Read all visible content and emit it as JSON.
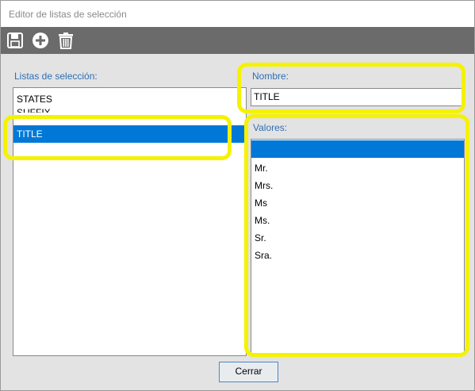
{
  "window": {
    "title": "Editor de listas de selección"
  },
  "toolbar": {
    "buttons": [
      {
        "icon": "save-icon"
      },
      {
        "icon": "add-icon"
      },
      {
        "icon": "delete-icon"
      }
    ]
  },
  "lists_panel": {
    "label": "Listas de selección:",
    "items": [
      {
        "label": "STATES"
      },
      {
        "label": "SUFFIX"
      },
      {
        "label": "TITLE",
        "selected": true
      }
    ]
  },
  "name_field": {
    "label": "Nombre:",
    "value": "TITLE"
  },
  "values_panel": {
    "label": "Valores:",
    "items": [
      {
        "label": "",
        "selected": true
      },
      {
        "label": "Mr."
      },
      {
        "label": "Mrs."
      },
      {
        "label": "Ms"
      },
      {
        "label": "Ms."
      },
      {
        "label": "Sr."
      },
      {
        "label": "Sra."
      }
    ]
  },
  "close_button": {
    "label": "Cerrar"
  },
  "colors": {
    "toolbar_bg": "#6b6b6b",
    "panel_bg": "#e3e3e3",
    "label_blue": "#2e6fb5",
    "selection_blue": "#0078d7",
    "highlight_yellow": "#f5f200"
  }
}
